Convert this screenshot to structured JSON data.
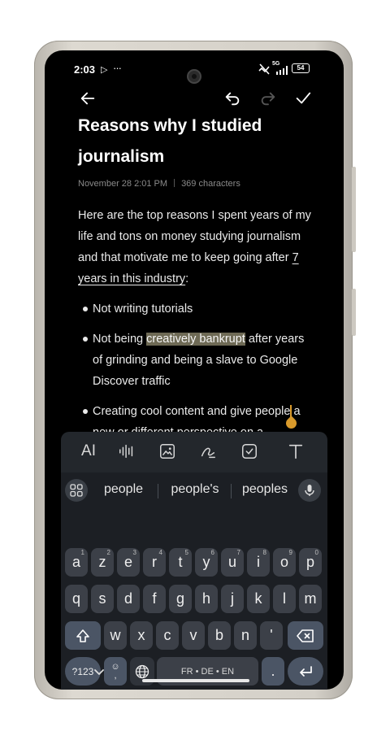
{
  "status_bar": {
    "time": "2:03",
    "battery": "54",
    "network": "5G"
  },
  "toolbar": {
    "back_icon": "arrow-left-icon",
    "undo_icon": "undo-icon",
    "redo_icon": "redo-icon",
    "done_icon": "check-icon"
  },
  "note": {
    "title": "Reasons why I studied journalism",
    "date": "November 28 2:01 PM",
    "characters": "369 characters",
    "intro_text": "Here are the top reasons I spent years of my life and tons on money studying journalism and that motivate me to keep going after ",
    "intro_link": "7 years in this industry",
    "intro_end": ":",
    "items": [
      {
        "text": "Not writing tutorials"
      },
      {
        "before": "Not being ",
        "highlight": "creatively bankrupt",
        "after": " after years of grinding and being a slave to Google Discover traffic"
      },
      {
        "text": "Creating cool content and give people a new or different perspective on a"
      }
    ]
  },
  "edit_tools": [
    {
      "name": "ai-tool-button",
      "label": "AI"
    },
    {
      "name": "voice-tool-button",
      "icon": "waveform-icon"
    },
    {
      "name": "image-tool-button",
      "icon": "image-icon"
    },
    {
      "name": "draw-tool-button",
      "icon": "pen-icon"
    },
    {
      "name": "checklist-tool-button",
      "icon": "checkbox-icon"
    },
    {
      "name": "text-format-button",
      "icon": "text-icon"
    }
  ],
  "keyboard": {
    "suggestions": [
      "people",
      "people's",
      "peoples"
    ],
    "row1": [
      {
        "key": "a",
        "hint": "1"
      },
      {
        "key": "z",
        "hint": "2"
      },
      {
        "key": "e",
        "hint": "3"
      },
      {
        "key": "r",
        "hint": "4"
      },
      {
        "key": "t",
        "hint": "5"
      },
      {
        "key": "y",
        "hint": "6"
      },
      {
        "key": "u",
        "hint": "7"
      },
      {
        "key": "i",
        "hint": "8"
      },
      {
        "key": "o",
        "hint": "9"
      },
      {
        "key": "p",
        "hint": "0"
      }
    ],
    "row2": [
      "q",
      "s",
      "d",
      "f",
      "g",
      "h",
      "j",
      "k",
      "l",
      "m"
    ],
    "row3": [
      "w",
      "x",
      "c",
      "v",
      "b",
      "n",
      "'"
    ],
    "sym_key": "?123",
    "emoji_comma": ",",
    "space_label": "FR • DE • EN",
    "period": "."
  },
  "colors": {
    "highlight": "#6e6a55",
    "cursor": "#d99a2b",
    "keyboard_bg": "#1c1f24"
  }
}
